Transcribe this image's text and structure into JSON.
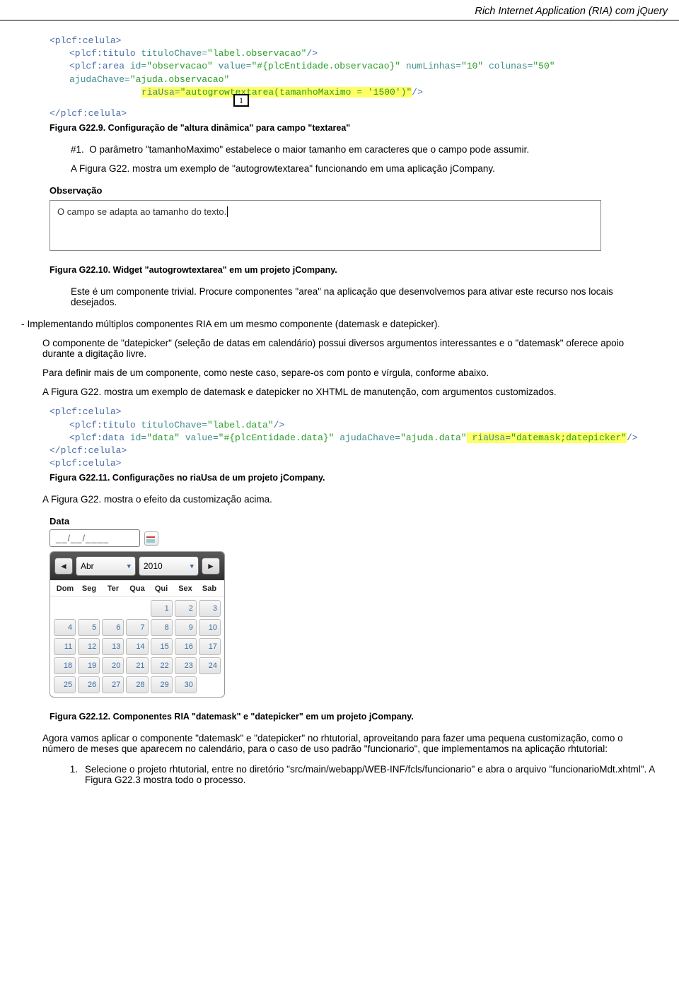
{
  "header": "Rich Internet Application (RIA) com jQuery",
  "code1": {
    "l1": {
      "tag_open": "<plcf:celula>",
      "tag_close": ""
    },
    "l2": {
      "tag_open": "<plcf:titulo ",
      "attr": "tituloChave=",
      "val": "\"label.observacao\"",
      "end": "/>"
    },
    "l3": {
      "tag_open": "<plcf:area ",
      "a1": "id=",
      "v1": "\"observacao\"",
      "a2": " value=",
      "v2": "\"#{plcEntidade.observacao}\"",
      "a3": " numLinhas=",
      "v3": "\"10\"",
      "a4": " colunas=",
      "v4": "\"50\"",
      "a5": " ajudaChave=",
      "v5": "\"ajuda.observacao\""
    },
    "l4": {
      "a": "riaUsa=",
      "v": "\"autogrowtextarea(tamanhoMaximo = '1500')\"",
      "end": "/>",
      "num": "1"
    },
    "l5": {
      "tag": "</plcf:celula>"
    }
  },
  "caption1": "Figura G22.9. Configuração de \"altura dinâmica\" para campo \"textarea\"",
  "item1_num": "#1.",
  "item1_text": "O parâmetro \"tamanhoMaximo\" estabelece o maior tamanho em caracteres que o campo pode assumir.",
  "p2": "A Figura G22. mostra um exemplo de \"autogrowtextarea\" funcionando em uma aplicação jCompany.",
  "obs_label": "Observação",
  "obs_value": "O campo se adapta ao tamanho do texto.",
  "caption2": "Figura G22.10. Widget \"autogrowtextarea\" em um projeto jCompany.",
  "p3": "Este é um componente trivial. Procure componentes \"area\" na aplicação que desenvolvemos para ativar este recurso nos locais desejados.",
  "dash_heading": "Implementando múltiplos componentes RIA em um mesmo componente (datemask e datepicker).",
  "p4": "O componente de \"datepicker\" (seleção de datas em calendário) possui diversos argumentos interessantes e o \"datemask\" oferece apoio durante a digitação livre.",
  "p5": "Para definir mais de um componente, como neste caso, separe-os com ponto e vírgula, conforme abaixo.",
  "p6": "A Figura G22. mostra um exemplo de datemask e datepicker no XHTML de manutenção, com argumentos customizados.",
  "code2": {
    "l1": "<plcf:celula>",
    "l2": {
      "tag": "<plcf:titulo ",
      "a": "tituloChave=",
      "v": "\"label.data\"",
      "end": "/>"
    },
    "l3": {
      "tag": "<plcf:data ",
      "a1": "id=",
      "v1": "\"data\"",
      "a2": " value=",
      "v2": "\"#{plcEntidade.data}\"",
      "a3": " ajudaChave=",
      "v3": "\"ajuda.data\"",
      "hl_a": " riaUsa=",
      "hl_v": "\"datemask;datepicker\"",
      "end": "/>"
    },
    "l4": "</plcf:celula>",
    "l5": "<plcf:celula>"
  },
  "caption3": "Figura G22.11.  Configurações no riaUsa de um projeto jCompany.",
  "p7": "A Figura G22. mostra o efeito da customização acima.",
  "dp": {
    "label": "Data",
    "input": "__/__/____",
    "month": "Abr",
    "year": "2010",
    "dow": [
      "Dom",
      "Seg",
      "Ter",
      "Qua",
      "Qui",
      "Sex",
      "Sab"
    ],
    "days": [
      [
        "",
        "",
        "",
        "",
        1,
        2,
        3
      ],
      [
        4,
        5,
        6,
        7,
        8,
        9,
        10
      ],
      [
        11,
        12,
        13,
        14,
        15,
        16,
        17
      ],
      [
        18,
        19,
        20,
        21,
        22,
        23,
        24
      ],
      [
        25,
        26,
        27,
        28,
        29,
        30,
        ""
      ]
    ]
  },
  "caption4": "Figura G22.12. Componentes RIA \"datemask\" e \"datepicker\" em um projeto jCompany.",
  "p8": "Agora vamos aplicar o componente \"datemask\" e \"datepicker\" no rhtutorial, aproveitando para fazer uma pequena customização, como o número de meses que aparecem no calendário, para o caso de uso padrão \"funcionario\", que implementamos na aplicação rhtutorial:",
  "step1_num": "1.",
  "step1_text": "Selecione o projeto rhtutorial, entre no diretório \"src/main/webapp/WEB-INF/fcls/funcionario\" e abra o arquivo \"funcionarioMdt.xhtml\".  A Figura G22.3 mostra todo o processo."
}
